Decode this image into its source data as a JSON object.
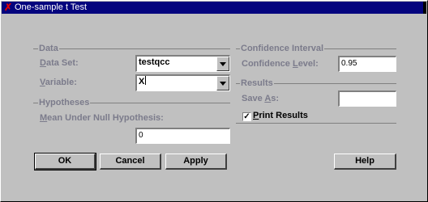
{
  "window": {
    "title": "One-sample t Test",
    "colors": {
      "titlebar": "#04047e",
      "background": "#c0c0c0",
      "label": "#7b7b8b"
    }
  },
  "data_group": {
    "label": "Data",
    "data_set": {
      "label_hot": "D",
      "label_rest": "ata Set:",
      "value": "testqcc"
    },
    "variable": {
      "label_hot": "V",
      "label_rest": "ariable:",
      "value": "X"
    }
  },
  "hypotheses_group": {
    "label": "Hypotheses",
    "mean_null": {
      "label_hot": "M",
      "label_rest": "ean Under Null Hypothesis:",
      "value": "0"
    }
  },
  "confidence_group": {
    "label": "Confidence Interval",
    "level": {
      "label_pre": "Confidence ",
      "label_hot": "L",
      "label_rest": "evel:",
      "value": "0.95"
    }
  },
  "results_group": {
    "label": "Results",
    "save_as": {
      "label_pre": "Save ",
      "label_hot": "A",
      "label_rest": "s:",
      "value": ""
    },
    "print_results": {
      "label_hot": "P",
      "label_rest": "rint Results",
      "checked": true,
      "mark": "✓"
    }
  },
  "buttons": {
    "ok": "OK",
    "cancel": "Cancel",
    "apply": "Apply",
    "help": "Help"
  }
}
